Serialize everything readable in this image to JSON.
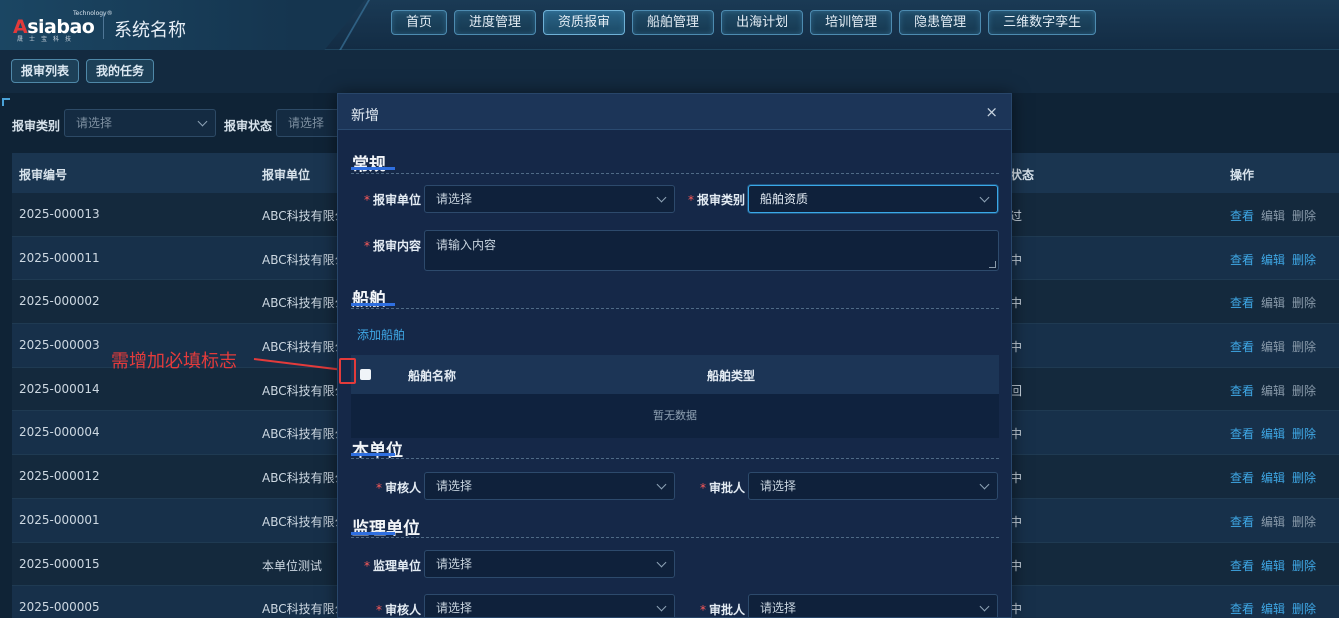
{
  "header": {
    "logo": {
      "tech": "Technology®",
      "main_red": "A",
      "main_rest": "siabao",
      "sub": "晟士宝科技"
    },
    "system_name": "系统名称",
    "nav": [
      {
        "label": "首页"
      },
      {
        "label": "进度管理"
      },
      {
        "label": "资质报审",
        "active": true
      },
      {
        "label": "船舶管理"
      },
      {
        "label": "出海计划"
      },
      {
        "label": "培训管理"
      },
      {
        "label": "隐患管理"
      },
      {
        "label": "三维数字孪生"
      }
    ]
  },
  "subtabs": [
    "报审列表",
    "我的任务"
  ],
  "filters": {
    "type_label": "报审类别",
    "type_placeholder": "请选择",
    "status_label": "报审状态",
    "status_placeholder": "请选择"
  },
  "table": {
    "headers": {
      "id": "报审编号",
      "unit": "报审单位",
      "status": "状态",
      "ops": "操作"
    },
    "ops": {
      "view": "查看",
      "edit": "编辑",
      "delete": "删除"
    },
    "rows": [
      {
        "id": "2025-000013",
        "unit": "ABC科技有限公",
        "status": "过",
        "active_ops": false
      },
      {
        "id": "2025-000011",
        "unit": "ABC科技有限公",
        "status": "中",
        "active_ops": true
      },
      {
        "id": "2025-000002",
        "unit": "ABC科技有限公",
        "status": "中",
        "active_ops": false
      },
      {
        "id": "2025-000003",
        "unit": "ABC科技有限公",
        "status": "中",
        "active_ops": false
      },
      {
        "id": "2025-000014",
        "unit": "ABC科技有限公",
        "status": "回",
        "active_ops": false
      },
      {
        "id": "2025-000004",
        "unit": "ABC科技有限公",
        "status": "中",
        "active_ops": true
      },
      {
        "id": "2025-000012",
        "unit": "ABC科技有限公",
        "status": "中",
        "active_ops": true
      },
      {
        "id": "2025-000001",
        "unit": "ABC科技有限公",
        "status": "中",
        "active_ops": false
      },
      {
        "id": "2025-000015",
        "unit": "本单位测试",
        "status": "中",
        "active_ops": true
      },
      {
        "id": "2025-000005",
        "unit": "ABC科技有限公",
        "status": "中",
        "active_ops": true
      }
    ]
  },
  "annotation": {
    "text": "需增加必填标志"
  },
  "modal": {
    "title": "新增",
    "close": "×",
    "general": {
      "title": "常规",
      "unit_label": "报审单位",
      "unit_value": "请选择",
      "type_label": "报审类别",
      "type_value": "船舶资质",
      "content_label": "报审内容",
      "content_placeholder": "请输入内容"
    },
    "ships": {
      "title": "船舶",
      "add_link": "添加船舶",
      "col_name": "船舶名称",
      "col_type": "船舶类型",
      "empty": "暂无数据"
    },
    "own_unit": {
      "title": "本单位",
      "reviewer_label": "审核人",
      "reviewer_value": "请选择",
      "approver_label": "审批人",
      "approver_value": "请选择"
    },
    "supervisor": {
      "title": "监理单位",
      "unit_label": "监理单位",
      "unit_value": "请选择",
      "reviewer_label": "审核人",
      "reviewer_value": "请选择",
      "approver_label": "审批人",
      "approver_value": "请选择"
    }
  }
}
